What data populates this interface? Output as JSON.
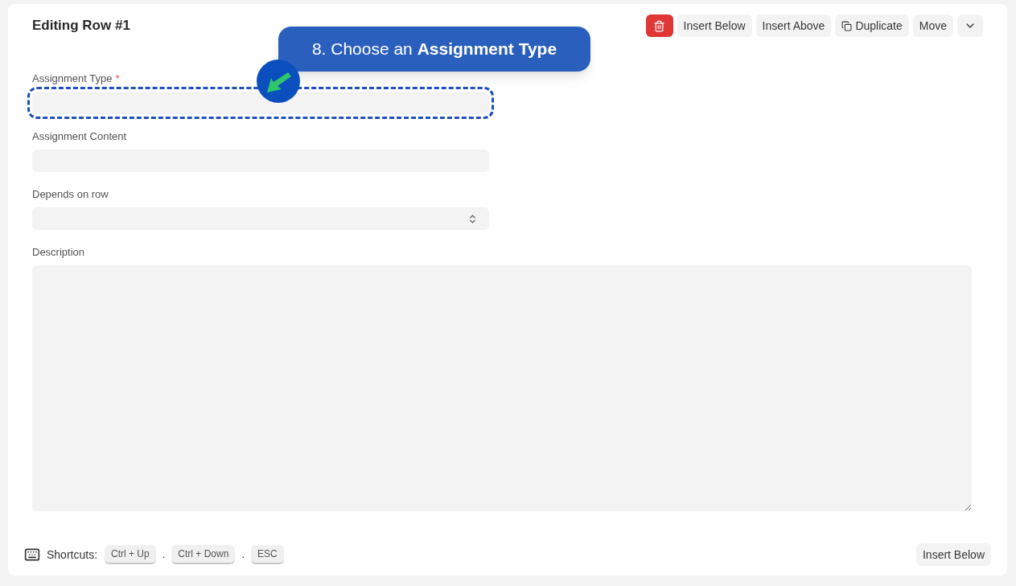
{
  "title": "Editing Row #1",
  "toolbar": [
    {
      "kind": "delete"
    },
    {
      "kind": "text",
      "label": "Insert Below"
    },
    {
      "kind": "text",
      "label": "Insert Above"
    },
    {
      "kind": "duplicate",
      "label": "Duplicate"
    },
    {
      "kind": "text",
      "label": "Move"
    },
    {
      "kind": "caret"
    }
  ],
  "fields": [
    {
      "label": "Assignment Type",
      "required": true,
      "kind": "input",
      "highlighted": true
    },
    {
      "label": "Assignment Content",
      "required": false,
      "kind": "input",
      "highlighted": false
    },
    {
      "label": "Depends on row",
      "required": false,
      "kind": "select",
      "highlighted": false
    },
    {
      "label": "Description",
      "required": false,
      "kind": "textarea",
      "highlighted": false
    }
  ],
  "required_marker": "*",
  "tour_callout": "8. Choose an **Assignment Type**",
  "shortcuts": {
    "label": "Shortcuts:",
    "keys": [
      "Ctrl + Up",
      "Ctrl + Down",
      "ESC"
    ],
    "separator": "."
  },
  "footer_button": "Insert Below"
}
